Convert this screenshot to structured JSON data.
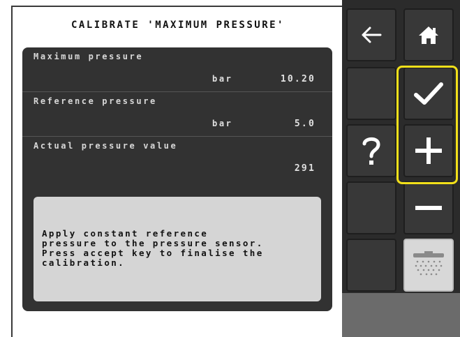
{
  "screen": {
    "title": "CALIBRATE 'MAXIMUM PRESSURE'"
  },
  "fields": [
    {
      "label": "Maximum pressure",
      "unit": "bar",
      "value": "10.20"
    },
    {
      "label": "Reference pressure",
      "unit": "bar",
      "value": "5.0"
    },
    {
      "label": "Actual pressure value",
      "unit": "",
      "value": "291"
    }
  ],
  "message": "Apply constant reference\npressure to the pressure sensor.\nPress accept key to finalise the\ncalibration.",
  "softkeys": {
    "back": "back-arrow-icon",
    "home": "home-icon",
    "accept": "checkmark-icon",
    "help": "question-mark-icon",
    "increase": "plus-icon",
    "decrease": "minus-icon",
    "sprayer": "sprayer-boom-icon"
  },
  "colors": {
    "highlight": "#f2e01a",
    "panel": "#323232",
    "softkey": "#383838"
  }
}
